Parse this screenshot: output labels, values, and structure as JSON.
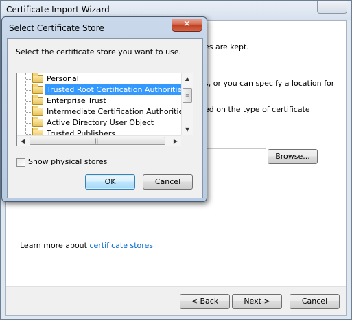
{
  "wizard": {
    "title": "Certificate Import Wizard",
    "fragments": {
      "stores_kept": "es are kept.",
      "specify_location": "s, or you can specify a location for",
      "based_on_type": "ed on the type of certificate"
    },
    "learn_more_prefix": "Learn more about ",
    "learn_more_link": "certificate stores",
    "browse_label": "Browse...",
    "back_label": "< Back",
    "next_label": "Next >",
    "cancel_label": "Cancel"
  },
  "dialog": {
    "title": "Select Certificate Store",
    "close_glyph": "✕",
    "instruction": "Select the certificate store you want to use.",
    "stores": [
      {
        "label": "Personal"
      },
      {
        "label": "Trusted Root Certification Authorities",
        "selected": true
      },
      {
        "label": "Enterprise Trust"
      },
      {
        "label": "Intermediate Certification Authorities"
      },
      {
        "label": "Active Directory User Object"
      },
      {
        "label": "Trusted Publishers"
      }
    ],
    "show_physical_label": "Show physical stores",
    "show_physical_checked": false,
    "ok_label": "OK",
    "cancel_label": "Cancel"
  },
  "colors": {
    "selection": "#3399ff",
    "link": "#0066cc",
    "close_button": "#c0401f"
  }
}
